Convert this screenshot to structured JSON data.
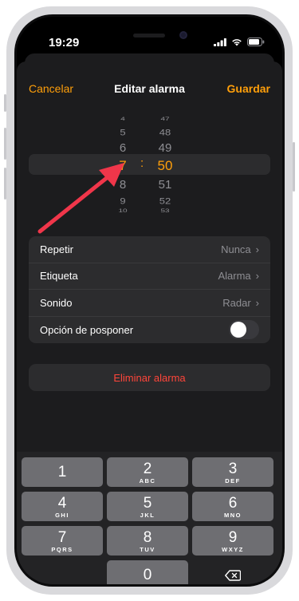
{
  "status_bar": {
    "time": "19:29"
  },
  "nav": {
    "cancel": "Cancelar",
    "title": "Editar alarma",
    "save": "Guardar"
  },
  "picker": {
    "hours": [
      "4",
      "5",
      "6",
      "7",
      "8",
      "9",
      "10"
    ],
    "minutes": [
      "47",
      "48",
      "49",
      "50",
      "51",
      "52",
      "53"
    ],
    "selected_hour": "7",
    "selected_minute": "50",
    "separator": ":"
  },
  "settings": {
    "repeat": {
      "label": "Repetir",
      "value": "Nunca"
    },
    "label": {
      "label": "Etiqueta",
      "value": "Alarma"
    },
    "sound": {
      "label": "Sonido",
      "value": "Radar"
    },
    "snooze": {
      "label": "Opción de posponer",
      "on": false
    }
  },
  "delete_label": "Eliminar alarma",
  "keypad": {
    "keys": [
      {
        "num": "1",
        "letters": ""
      },
      {
        "num": "2",
        "letters": "ABC"
      },
      {
        "num": "3",
        "letters": "DEF"
      },
      {
        "num": "4",
        "letters": "GHI"
      },
      {
        "num": "5",
        "letters": "JKL"
      },
      {
        "num": "6",
        "letters": "MNO"
      },
      {
        "num": "7",
        "letters": "PQRS"
      },
      {
        "num": "8",
        "letters": "TUV"
      },
      {
        "num": "9",
        "letters": "WXYZ"
      }
    ],
    "zero": "0"
  },
  "colors": {
    "accent": "#ff9f0a",
    "destructive": "#ff453a",
    "annotation_arrow": "#f0364a"
  },
  "icons": [
    "signal-icon",
    "wifi-icon",
    "battery-icon",
    "chevron-right-icon",
    "delete-backspace-icon"
  ]
}
